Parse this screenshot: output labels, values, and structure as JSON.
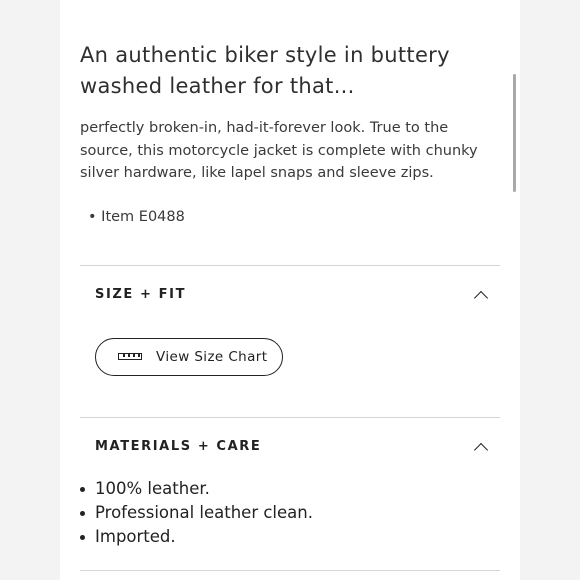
{
  "product": {
    "headline": "An authentic biker style in buttery washed leather for that...",
    "description": "perfectly broken-in, had-it-forever look. True to the source, this motorcycle jacket is complete with chunky silver hardware, like lapel snaps and sleeve zips.",
    "item_number": "• Item E0488"
  },
  "size_fit": {
    "title": "SIZE + FIT",
    "size_chart_button": "View Size Chart",
    "icons": {
      "chevron": "chevron-up-icon",
      "ruler": "ruler-icon"
    }
  },
  "materials_care": {
    "title": "MATERIALS + CARE",
    "items": [
      "100% leather.",
      "Professional leather clean.",
      "Imported."
    ]
  }
}
